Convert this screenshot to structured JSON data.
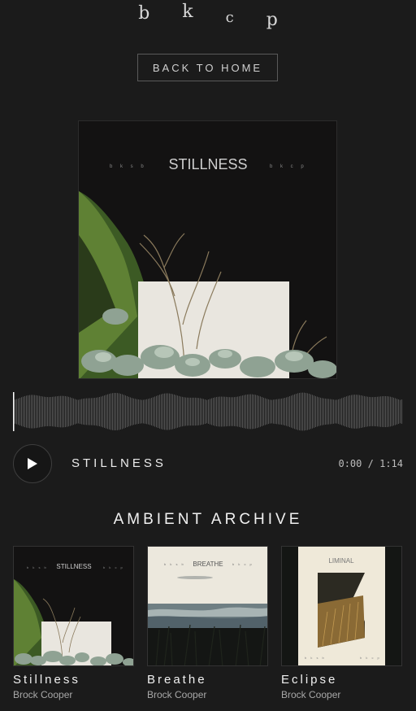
{
  "brand": {
    "letters": [
      "b",
      "k",
      "c",
      "p"
    ]
  },
  "nav": {
    "back_label": "BACK TO HOME"
  },
  "now_playing": {
    "cover_title": "STILLNESS",
    "title": "STILLNESS",
    "current_time": "0:00",
    "separator": "/",
    "duration": "1:14",
    "progress": 0.0
  },
  "archive": {
    "heading": "AMBIENT ARCHIVE",
    "albums": [
      {
        "title": "Stillness",
        "artist": "Brock Cooper",
        "cover_text": "STILLNESS"
      },
      {
        "title": "Breathe",
        "artist": "Brock Cooper",
        "cover_text": "BREATHE"
      },
      {
        "title": "Eclipse",
        "artist": "Brock Cooper",
        "cover_text": "LIMINAL"
      }
    ]
  },
  "icons": {
    "play": "play-icon"
  },
  "colors": {
    "background": "#1b1b1b",
    "text": "#e8e8e8",
    "muted": "#a8a8a8",
    "waveform": "#8a8a8a"
  }
}
